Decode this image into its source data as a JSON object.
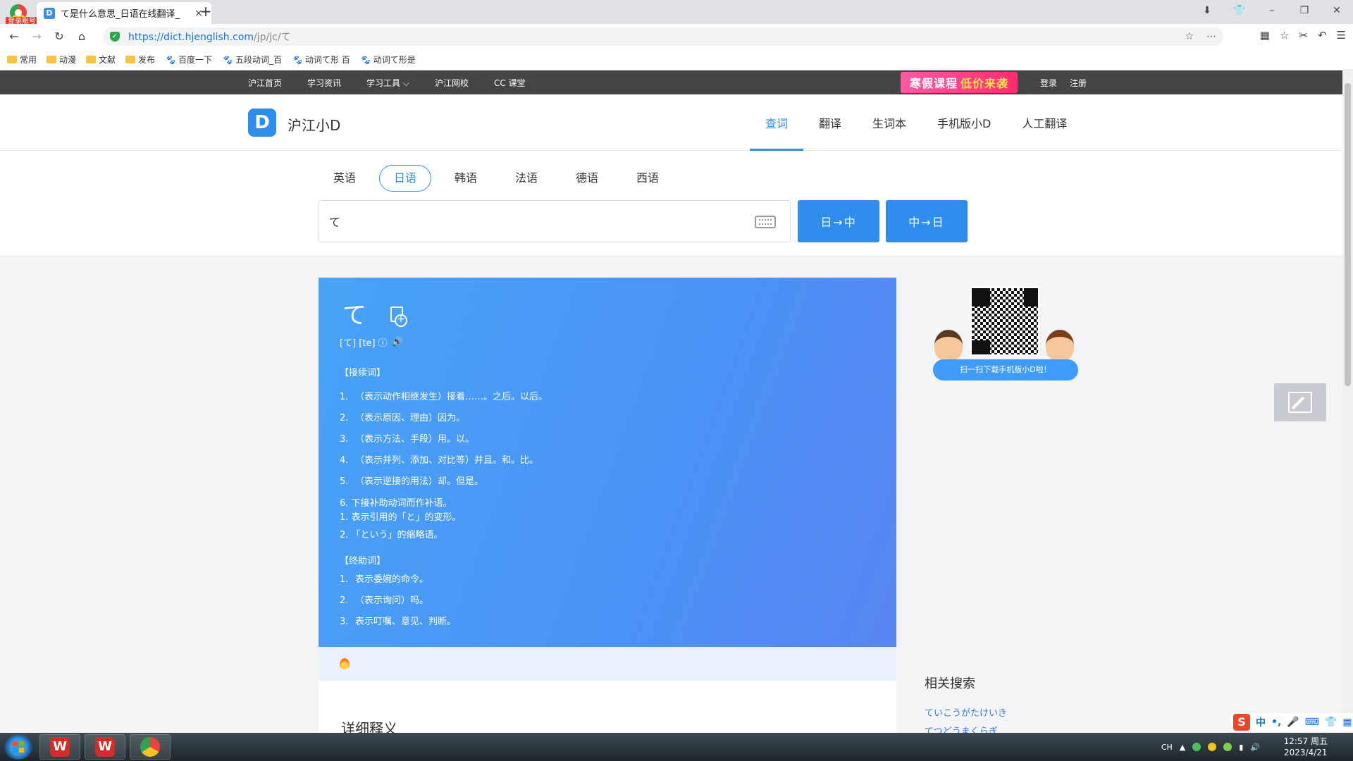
{
  "browser": {
    "login_tag": "登录账号",
    "tab_title": "て是什么意思_日语在线翻译_",
    "tab_close": "×",
    "new_tab": "+",
    "url_host": "https://dict.hjenglish.com",
    "url_path": "/jp/jc/て",
    "bookmarks": [
      "常用",
      "动漫",
      "文献",
      "发布",
      "百度一下",
      "五段动词_百",
      "动词て形 百",
      "动词て形是"
    ]
  },
  "site_top": {
    "links": [
      "沪江首页",
      "学习资讯",
      "学习工具 ⌵",
      "沪江网校",
      "CC 课堂"
    ],
    "promo_a": "寒假课程",
    "promo_b": "低价来袭",
    "login": "登录",
    "register": "注册"
  },
  "header": {
    "logo_letter": "D",
    "logo_text": "沪江小D",
    "nav": [
      "查词",
      "翻译",
      "生词本",
      "手机版小D",
      "人工翻译"
    ]
  },
  "search": {
    "languages": [
      "英语",
      "日语",
      "韩语",
      "法语",
      "德语",
      "西语"
    ],
    "query": "て",
    "btn_jc": "日→中",
    "btn_cj": "中→日"
  },
  "entry": {
    "word": "て",
    "pron": "[て] [te] ⓘ",
    "pos1": "【接续词】",
    "defs1": [
      {
        "n": "1.",
        "t": "（表示动作相继发生）接着……。之后。以后。"
      },
      {
        "n": "2.",
        "t": "（表示原因、理由）因为。"
      },
      {
        "n": "3.",
        "t": "（表示方法、手段）用。以。"
      },
      {
        "n": "4.",
        "t": "（表示并列、添加、对比等）并且。和。比。"
      },
      {
        "n": "5.",
        "t": "（表示逆接的用法）却。但是。"
      }
    ],
    "def6": "6.  下接补助动词而作补语。",
    "subs": [
      "1.  表示引用的「と」的变形。",
      "2.  「という」的缩略语。"
    ],
    "pos2": "【终助词】",
    "defs2": [
      {
        "n": "1.",
        "t": "表示委婉的命令。"
      },
      {
        "n": "2.",
        "t": "（表示询问）吗。"
      },
      {
        "n": "3.",
        "t": "表示叮嘱、意见、判断。"
      }
    ],
    "detail_title": "详细释义"
  },
  "sidebar": {
    "qr_caption": "扫一扫下载手机版小D啦！",
    "related_title": "相关搜索",
    "related": [
      "ていこうがたけいき",
      "てつどうまくらぎ"
    ]
  },
  "ime": {
    "items": [
      "中",
      "•,",
      "🎤",
      "⌨",
      "👕",
      "▦"
    ]
  },
  "taskbar": {
    "lang": "CH",
    "time": "12:57 周五",
    "date": "2023/4/21"
  }
}
